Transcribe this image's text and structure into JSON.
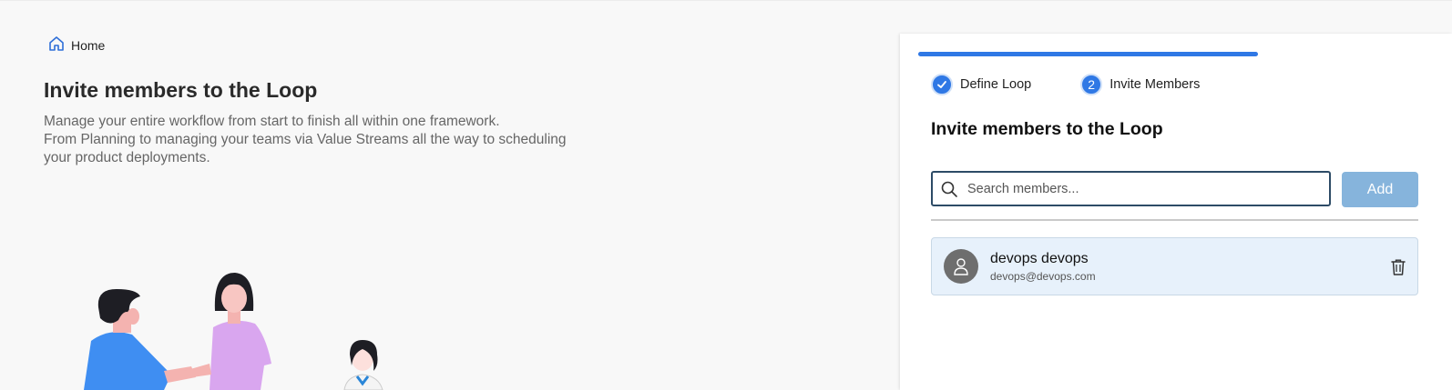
{
  "breadcrumb": {
    "home_label": "Home"
  },
  "intro": {
    "title": "Invite members to the Loop",
    "description_lines": [
      "Manage your entire workflow from start to finish all within one framework.",
      "From Planning to managing your teams via Value Streams all the way to scheduling",
      "your product deployments."
    ]
  },
  "wizard": {
    "progress_percent": 67,
    "steps": [
      {
        "label": "Define Loop",
        "state": "completed",
        "icon": "check-icon"
      },
      {
        "label": "Invite Members",
        "state": "active",
        "number": "2"
      }
    ],
    "title": "Invite members to the Loop",
    "search": {
      "placeholder": "Search members...",
      "value": ""
    },
    "add_label": "Add",
    "members": [
      {
        "name": "devops devops",
        "email": "devops@devops.com",
        "avatar_icon": "person-icon",
        "remove_icon": "trash-icon"
      }
    ]
  },
  "colors": {
    "accent": "#2f78e5",
    "add_button": "#86b4dc",
    "member_bg": "#e7f1fb"
  }
}
